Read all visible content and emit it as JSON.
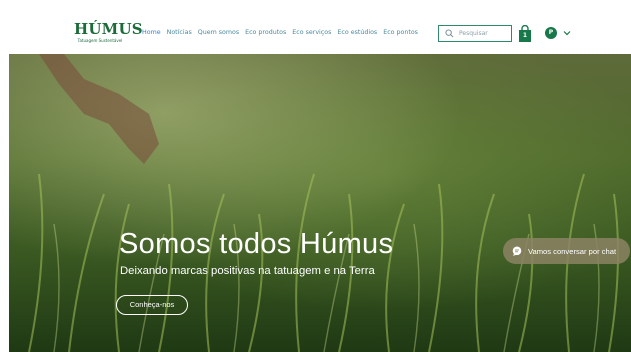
{
  "logo": {
    "name": "HÚMUS",
    "tagline": "Tatuagem Sustentável"
  },
  "nav": {
    "items": [
      {
        "label": "Home",
        "active": true
      },
      {
        "label": "Notícias",
        "active": false
      },
      {
        "label": "Quem somos",
        "active": false
      },
      {
        "label": "Eco produtos",
        "active": false
      },
      {
        "label": "Eco serviços",
        "active": false
      },
      {
        "label": "Eco estúdios",
        "active": false
      },
      {
        "label": "Eco pontos",
        "active": false
      }
    ]
  },
  "search": {
    "placeholder": "Pesquisar",
    "icon": "search-icon"
  },
  "cart": {
    "count": "1",
    "icon": "shopping-bag-icon"
  },
  "account": {
    "initial": "P",
    "icon": "chevron-down-icon"
  },
  "hero": {
    "title": "Somos todos Húmus",
    "subtitle": "Deixando marcas positivas na tatuagem e na Terra",
    "cta_label": "Conheça-nos"
  },
  "chat": {
    "label": "Vamos conversar por chat",
    "icon": "chat-bubble-icon"
  },
  "colors": {
    "brand_green": "#1c6b3a",
    "nav_text": "#4a8a9c",
    "nav_active": "#3a7fd0",
    "avatar": "#17784a"
  }
}
